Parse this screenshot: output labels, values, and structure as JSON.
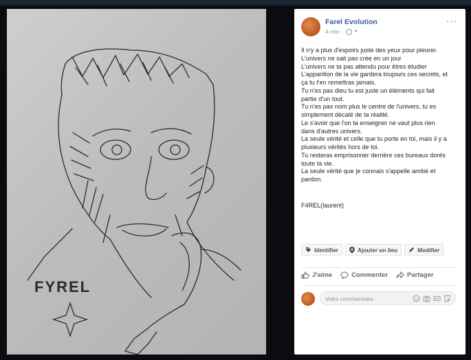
{
  "post": {
    "author": "Farel Evolution",
    "time": "4 min",
    "separator": "·",
    "privacy_icon": "globe-icon",
    "more_label": "···",
    "lines": [
      "Il n'y a plus d'espoirs juste des yeux pour pleurer.",
      "L'univers ne sait pas crée en un jour",
      "L'univers ne ta pas attendu pour êtres étudier",
      "L'apparition de la vie gardera toujours ces secrets, et",
      "ça tu t'en remettras jamais.",
      "Tu n'es pas dieu tu est juste un éléments qui fait",
      "partie d'un tout.",
      "Tu n'es pas nom plus le centre de l'univers, tu es",
      "simplement décalé de ta réalité.",
      "Le s'avoir que l'on ta enseigner ne vaut plus rien",
      "dans d'autres univers.",
      "La seule vérité et celle que tu porte en toi, mais il y a",
      "plusieurs vérités hors de toi.",
      "Tu resteras emprisonner derrière ces bureaux dorés",
      "toute ta vie.",
      "La seule vérité que je connais s'appelle amitié et",
      "pardon."
    ],
    "signature": "F4REL(laurent)"
  },
  "photo_tools": {
    "tag": "Identifier",
    "location": "Ajouter un lieu",
    "edit": "Modifier"
  },
  "actions": {
    "like": "J'aime",
    "comment": "Commenter",
    "share": "Partager"
  },
  "comment_box": {
    "placeholder": "Votre commentaire..."
  },
  "drawing": {
    "label": "FYREL"
  },
  "colors": {
    "link": "#385898",
    "text": "#1d2129",
    "muted": "#90949c",
    "background": "#0b0c0f"
  }
}
